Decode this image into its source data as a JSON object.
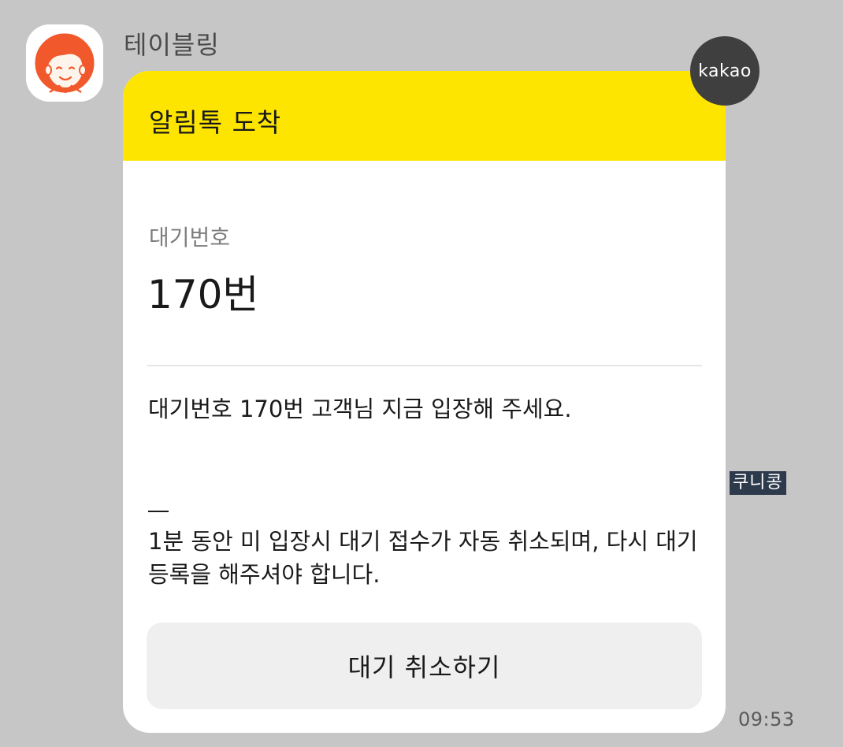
{
  "sender": {
    "name": "테이블링",
    "avatar": "cartoon-person-avatar"
  },
  "badge": {
    "label": "kakao"
  },
  "card": {
    "header_title": "알림톡 도착",
    "header_color": "#fee500",
    "wait_label": "대기번호",
    "wait_number": "170번",
    "message": "대기번호 170번 고객님 지금 입장해 주세요.",
    "notice": "1분 동안 미 입장시 대기 접수가 자동 취소되며, 다시 대기 등록을 해주셔야 합니다.",
    "cancel_button_label": "대기 취소하기"
  },
  "side_tag": "쿠니콩",
  "timestamp": "09:53",
  "colors": {
    "background": "#c6c6c6",
    "accent": "#fee500",
    "avatar_hair": "#f1582b"
  }
}
